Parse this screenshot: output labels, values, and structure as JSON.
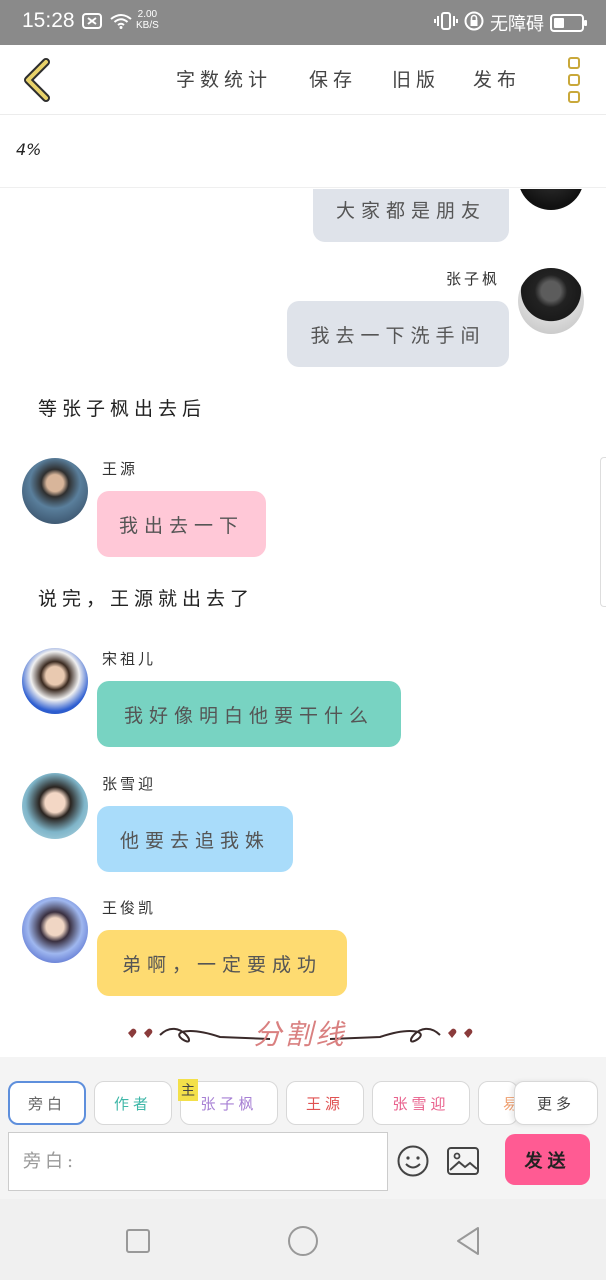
{
  "status_bar": {
    "time": "15:28",
    "net_speed_value": "2.00",
    "net_speed_unit": "KB/S",
    "accessibility_label": "无障碍"
  },
  "toolbar": {
    "items": [
      "字数统计",
      "保存",
      "旧版",
      "发布"
    ]
  },
  "progress": {
    "percent_text": "4%"
  },
  "messages": {
    "m0": {
      "text": "大家都是朋友"
    },
    "m1": {
      "name": "张子枫",
      "text": "我去一下洗手间"
    },
    "n1": {
      "text": "等张子枫出去后"
    },
    "m2": {
      "name": "王源",
      "text": "我出去一下"
    },
    "n2": {
      "text": "说完，王源就出去了"
    },
    "m3": {
      "name": "宋祖儿",
      "text": "我好像明白他要干什么"
    },
    "m4": {
      "name": "张雪迎",
      "text": "他要去追我姝"
    },
    "m5": {
      "name": "王俊凯",
      "text": "弟啊，一定要成功"
    }
  },
  "divider": {
    "text": "分割线"
  },
  "roles": {
    "chips": [
      "旁白",
      "作者",
      "张子枫",
      "王源",
      "张雪迎",
      "易"
    ],
    "main_badge": "主",
    "more": "更多"
  },
  "input": {
    "placeholder": "旁白:"
  },
  "send_label": "发送",
  "colors": {
    "right_bubble": "#dfe3ea",
    "pink_bubble": "#ffc8d7",
    "teal_bubble": "#78d3c2",
    "blue_bubble": "#a9dcfa",
    "yellow_bubble": "#fedb71",
    "send_button": "#ff5b93",
    "accent_gold": "#c9a83a"
  }
}
